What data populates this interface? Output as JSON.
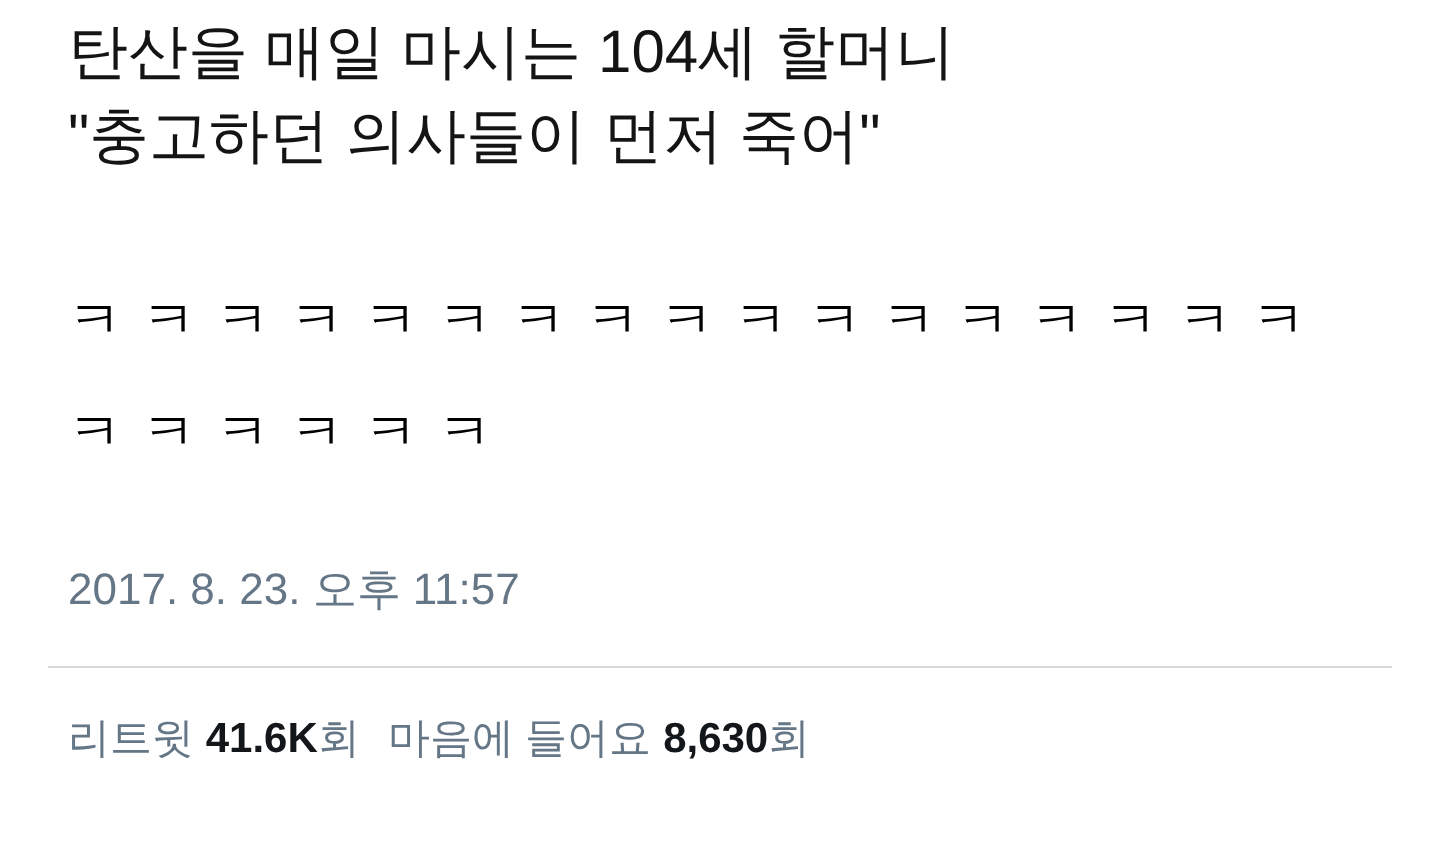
{
  "tweet": {
    "title_lines": [
      "탄산을 매일 마시는 104세 할머니",
      "\"충고하던 의사들이 먼저 죽어\""
    ],
    "body": "ㅋㅋㅋㅋㅋㅋㅋㅋㅋㅋㅋㅋㅋㅋㅋㅋㅋㅋㅋㅋㅋㅋㅋ",
    "timestamp": "2017. 8. 23. 오후 11:57",
    "stats": [
      "리트윗 **41.6K**회",
      "마음에 들어요 **8,630**회"
    ]
  }
}
